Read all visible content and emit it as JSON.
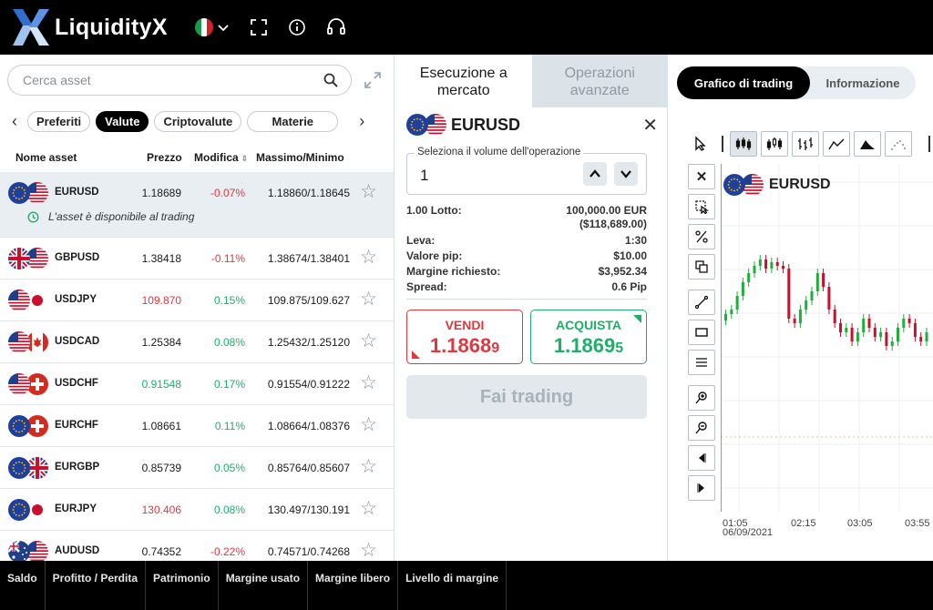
{
  "brand": {
    "name": "LiquidityX"
  },
  "topbar": {
    "icons": [
      "flag-italy",
      "chevron-down-icon",
      "fullscreen-icon",
      "info-icon",
      "headset-icon"
    ]
  },
  "search": {
    "placeholder": "Cerca asset"
  },
  "categories": {
    "items": [
      "Preferiti",
      "Valute",
      "Criptovalute",
      "Materie"
    ],
    "active": "Valute"
  },
  "table": {
    "headers": {
      "name": "Nome asset",
      "price": "Prezzo",
      "change": "Modifica",
      "highlow": "Massimo/Minimo"
    },
    "rows": [
      {
        "symbol": "EURUSD",
        "price": "1.18689",
        "change": "-0.07%",
        "highlow": "1.18860/1.18645",
        "price_color": "#1a1a1a",
        "change_color": "#e0383e",
        "flags": [
          "eu",
          "us"
        ],
        "selected": true,
        "note": "L'asset è disponibile al trading"
      },
      {
        "symbol": "GBPUSD",
        "price": "1.38418",
        "change": "-0.11%",
        "highlow": "1.38674/1.38401",
        "price_color": "#1a1a1a",
        "change_color": "#e0383e",
        "flags": [
          "gb",
          "us"
        ]
      },
      {
        "symbol": "USDJPY",
        "price": "109.870",
        "change": "0.15%",
        "highlow": "109.875/109.627",
        "price_color": "#e0383e",
        "change_color": "#1eaf6a",
        "flags": [
          "us",
          "jp"
        ]
      },
      {
        "symbol": "USDCAD",
        "price": "1.25384",
        "change": "0.08%",
        "highlow": "1.25432/1.25120",
        "price_color": "#1a1a1a",
        "change_color": "#1eaf6a",
        "flags": [
          "us",
          "ca"
        ]
      },
      {
        "symbol": "USDCHF",
        "price": "0.91548",
        "change": "0.17%",
        "highlow": "0.91554/0.91222",
        "price_color": "#1eaf6a",
        "change_color": "#1eaf6a",
        "flags": [
          "us",
          "ch"
        ]
      },
      {
        "symbol": "EURCHF",
        "price": "1.08661",
        "change": "0.11%",
        "highlow": "1.08664/1.08376",
        "price_color": "#1a1a1a",
        "change_color": "#1eaf6a",
        "flags": [
          "eu",
          "ch"
        ]
      },
      {
        "symbol": "EURGBP",
        "price": "0.85739",
        "change": "0.05%",
        "highlow": "0.85764/0.85607",
        "price_color": "#1a1a1a",
        "change_color": "#1eaf6a",
        "flags": [
          "eu",
          "gb"
        ]
      },
      {
        "symbol": "EURJPY",
        "price": "130.406",
        "change": "0.08%",
        "highlow": "130.497/130.191",
        "price_color": "#e0383e",
        "change_color": "#1eaf6a",
        "flags": [
          "eu",
          "jp"
        ]
      },
      {
        "symbol": "AUDUSD",
        "price": "0.74352",
        "change": "-0.22%",
        "highlow": "0.74571/0.74268",
        "price_color": "#1a1a1a",
        "change_color": "#e0383e",
        "flags": [
          "au",
          "us"
        ]
      }
    ]
  },
  "order": {
    "tabs": {
      "market_l1": "Esecuzione a",
      "market_l2": "mercato",
      "advanced_l1": "Operazioni",
      "advanced_l2": "avanzate"
    },
    "symbol": "EURUSD",
    "volume_label": "Seleziona il volume dell'operazione",
    "volume_value": "1",
    "details": {
      "lot_label": "1.00 Lotto:",
      "lot_value": "100,000.00 EUR",
      "lot_value2": "($118,689.00)",
      "leverage_label": "Leva:",
      "leverage_value": "1:30",
      "pip_label": "Valore pip:",
      "pip_value": "$10.00",
      "margin_label": "Margine richiesto:",
      "margin_value": "$3,952.34",
      "spread_label": "Spread:",
      "spread_value": "0.6 Pip"
    },
    "sell": {
      "label": "VENDI",
      "price_main": "1.1868",
      "price_small": "9"
    },
    "buy": {
      "label": "ACQUISTA",
      "price_main": "1.1869",
      "price_small": "5"
    },
    "trade_button": "Fai trading"
  },
  "chart_panel": {
    "tabs": {
      "chart": "Grafico di trading",
      "info": "Informazione"
    },
    "symbol": "EURUSD",
    "x_labels": [
      "01:05",
      "02:15",
      "03:05",
      "03:55"
    ],
    "x_date": "06/09/2021",
    "colors": {
      "up": "#1eaf3a",
      "down": "#c8102e"
    }
  },
  "bottombar": {
    "items": [
      "Saldo",
      "Profitto / Perdita",
      "Patrimonio",
      "Margine usato",
      "Margine libero",
      "Livello di margine"
    ]
  }
}
